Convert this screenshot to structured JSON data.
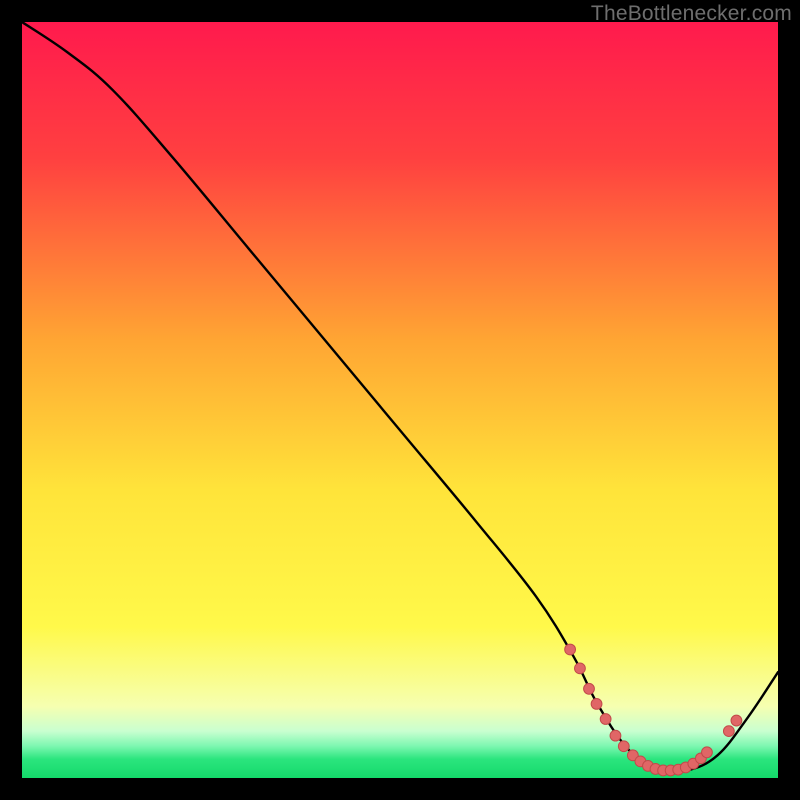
{
  "watermark": "TheBottlenecker.com",
  "colors": {
    "frame": "#000000",
    "curve": "#000000",
    "dot_fill": "#e06666",
    "dot_stroke": "#c24a4a",
    "grad_stops": [
      {
        "offset": 0.0,
        "color": "#ff1a4d"
      },
      {
        "offset": 0.18,
        "color": "#ff4040"
      },
      {
        "offset": 0.42,
        "color": "#ffa533"
      },
      {
        "offset": 0.62,
        "color": "#ffe43a"
      },
      {
        "offset": 0.8,
        "color": "#fff94a"
      },
      {
        "offset": 0.905,
        "color": "#f6ffb0"
      },
      {
        "offset": 0.938,
        "color": "#c9ffd0"
      },
      {
        "offset": 0.958,
        "color": "#7cf7b0"
      },
      {
        "offset": 0.975,
        "color": "#2be57e"
      },
      {
        "offset": 1.0,
        "color": "#14d96a"
      }
    ]
  },
  "chart_data": {
    "type": "line",
    "title": "",
    "xlabel": "",
    "ylabel": "",
    "xlim": [
      0,
      100
    ],
    "ylim": [
      0,
      100
    ],
    "series": [
      {
        "name": "bottleneck-curve",
        "x": [
          0,
          6,
          12,
          20,
          30,
          40,
          50,
          60,
          68,
          73,
          76,
          80,
          84,
          88,
          92,
          96,
          100
        ],
        "y": [
          100,
          96,
          91,
          82,
          70,
          58,
          46,
          34,
          24,
          16,
          10,
          4,
          1,
          1,
          3,
          8,
          14
        ]
      }
    ],
    "highlight_points": {
      "name": "optimal-range-dots",
      "x": [
        72.5,
        73.8,
        75.0,
        76.0,
        77.2,
        78.5,
        79.6,
        80.8,
        81.8,
        82.8,
        83.8,
        84.8,
        85.8,
        86.8,
        87.8,
        88.8,
        89.8,
        90.6,
        93.5,
        94.5
      ],
      "y": [
        17.0,
        14.5,
        11.8,
        9.8,
        7.8,
        5.6,
        4.2,
        3.0,
        2.2,
        1.6,
        1.2,
        1.0,
        1.0,
        1.1,
        1.4,
        1.9,
        2.6,
        3.4,
        6.2,
        7.6
      ]
    }
  }
}
